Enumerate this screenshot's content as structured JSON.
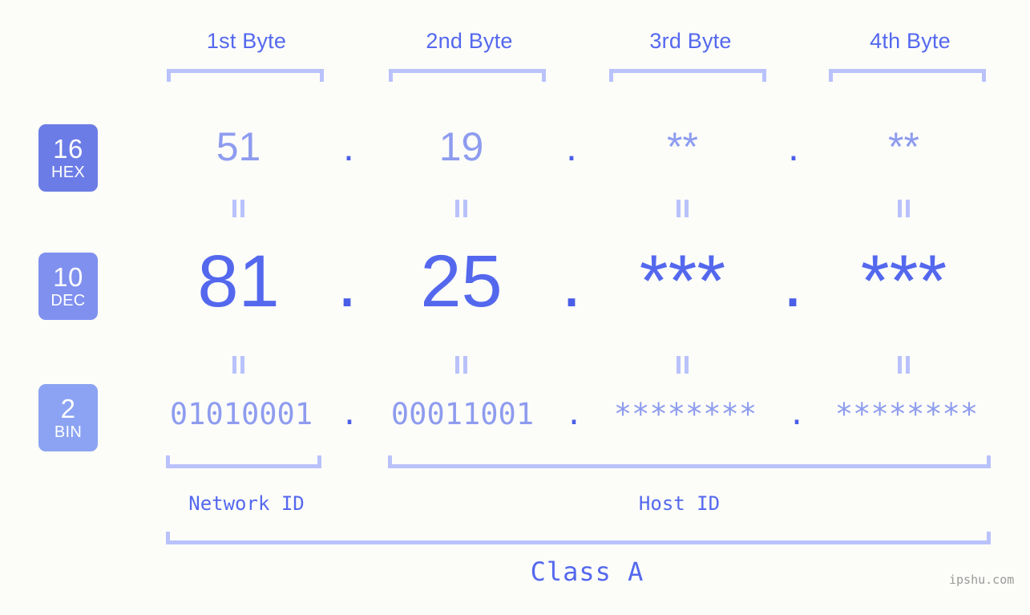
{
  "background_color": "#fcfdf9",
  "accent_colors": {
    "strong_blue": "#5468ee",
    "light_blue": "#8e9cef",
    "bracket": "#b9c2fb",
    "badge_hex": "#6c7ce6",
    "badge_dec": "#8090ef",
    "badge_bin": "#8ba3f2",
    "watermark": "#9a9a9a"
  },
  "byte_headers": [
    {
      "label": "1st Byte"
    },
    {
      "label": "2nd Byte"
    },
    {
      "label": "3rd Byte"
    },
    {
      "label": "4th Byte"
    }
  ],
  "rows": [
    {
      "base_number": "16",
      "base_name": "HEX",
      "values": [
        "51",
        "19",
        "**",
        "**"
      ],
      "separator": "."
    },
    {
      "base_number": "10",
      "base_name": "DEC",
      "values": [
        "81",
        "25",
        "***",
        "***"
      ],
      "separator": "."
    },
    {
      "base_number": "2",
      "base_name": "BIN",
      "values": [
        "01010001",
        "00011001",
        "********",
        "********"
      ],
      "separator": "."
    }
  ],
  "equals_marks": {
    "glyph": "||",
    "count_per_gap": 4,
    "gaps": 2
  },
  "id_sections": [
    {
      "label": "Network ID"
    },
    {
      "label": "Host ID"
    }
  ],
  "class_label": "Class A",
  "watermark": "ipshu.com"
}
